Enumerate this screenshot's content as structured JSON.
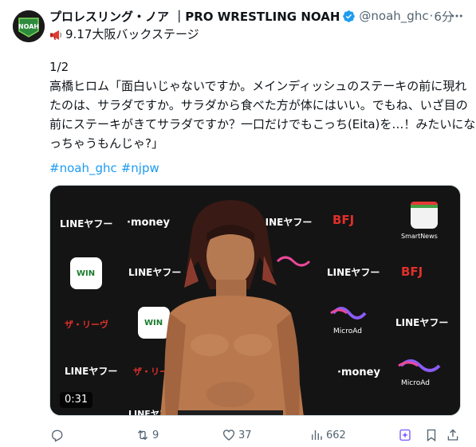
{
  "author": {
    "display_name": "プロレスリング・ノア ｜PRO WRESTLING NOAH",
    "handle": "@noah_ghc",
    "separator": "·",
    "time": "6分",
    "avatar_text": "NOAH",
    "verified_color": "#1d9bf0"
  },
  "tweet": {
    "line1": "9.17大阪バックステージ",
    "line2": "1/2",
    "line3": "高橋ヒロム「面白いじゃないですか。メインディッシュのステーキの前に現れ",
    "line4": "たのは、サラダですか。サラダから食べた方が体にはいい。でもね、いざ目の",
    "line5": "前にステーキがきてサラダですか？一口だけでもこっち(Eita)を…！みたいにな",
    "line6": "っちゃうもんじゃ?」",
    "hashtags": [
      "#noah_ghc",
      "#njpw"
    ]
  },
  "media": {
    "duration": "0:31",
    "sponsor_logos": [
      "LINEヤフー",
      "·money",
      "BFJ",
      "SmartNews",
      "WIN WINTICKET",
      "ザ・リーヴ",
      "MicroAd"
    ]
  },
  "actions": {
    "reply_count": "",
    "retweet_count": "9",
    "like_count": "37",
    "view_count": "662"
  },
  "colors": {
    "accent": "#1d9bf0",
    "secondary_text": "#536471",
    "text": "#0f1419",
    "bookmark": "#7856ff"
  }
}
